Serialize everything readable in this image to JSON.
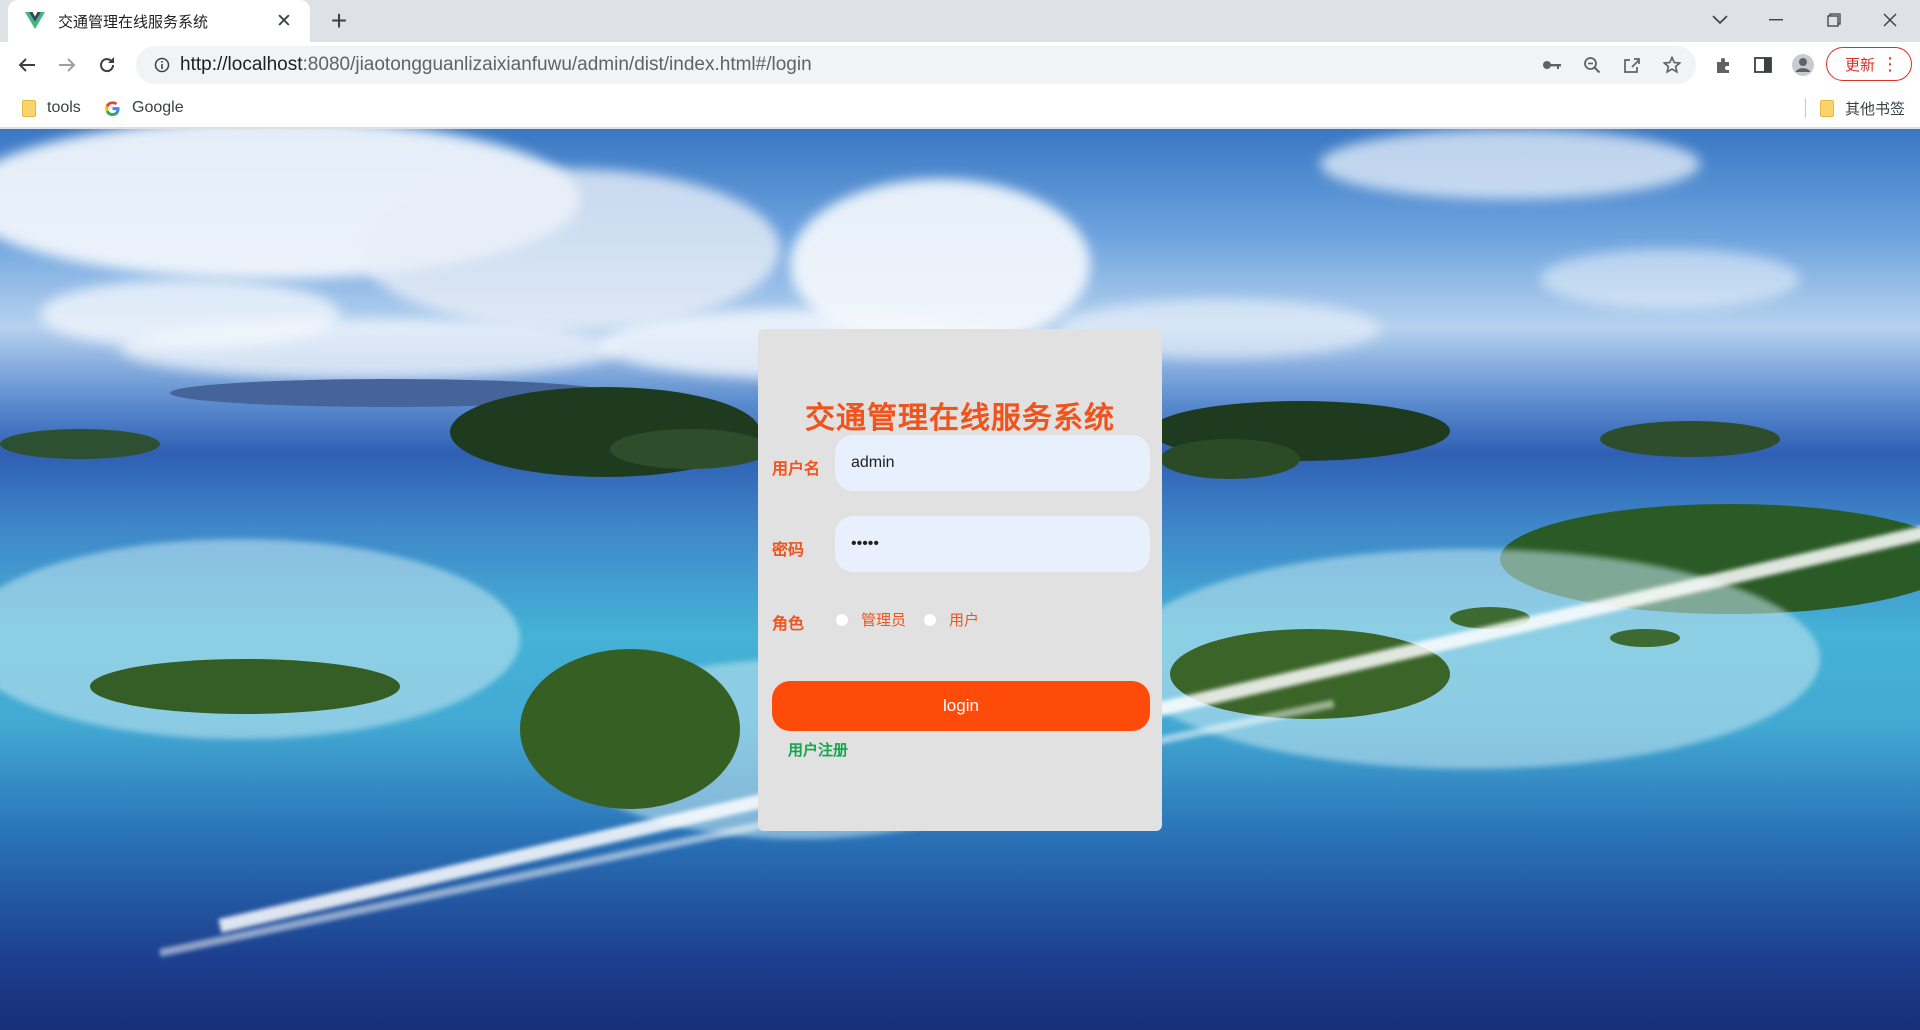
{
  "browser": {
    "tab_title": "交通管理在线服务系统",
    "url_host": "http://localhost",
    "url_rest": ":8080/jiaotongguanlizaixianfuwu/admin/dist/index.html#/login",
    "update_label": "更新",
    "bookmarks": [
      {
        "label": "tools",
        "icon": "folder-icon"
      },
      {
        "label": "Google",
        "icon": "google-icon"
      }
    ],
    "other_bookmarks": "其他书签"
  },
  "login": {
    "title": "交通管理在线服务系统",
    "username_label": "用户名",
    "username_value": "admin",
    "password_label": "密码",
    "password_value": "•••••",
    "role_label": "角色",
    "roles": [
      "管理员",
      "用户"
    ],
    "login_button": "login",
    "register_link": "用户注册"
  },
  "colors": {
    "accent": "#f0531b",
    "button": "#ff4b0a",
    "register": "#13a64a",
    "card": "#e1e1e1",
    "input": "#e8f0fe"
  }
}
